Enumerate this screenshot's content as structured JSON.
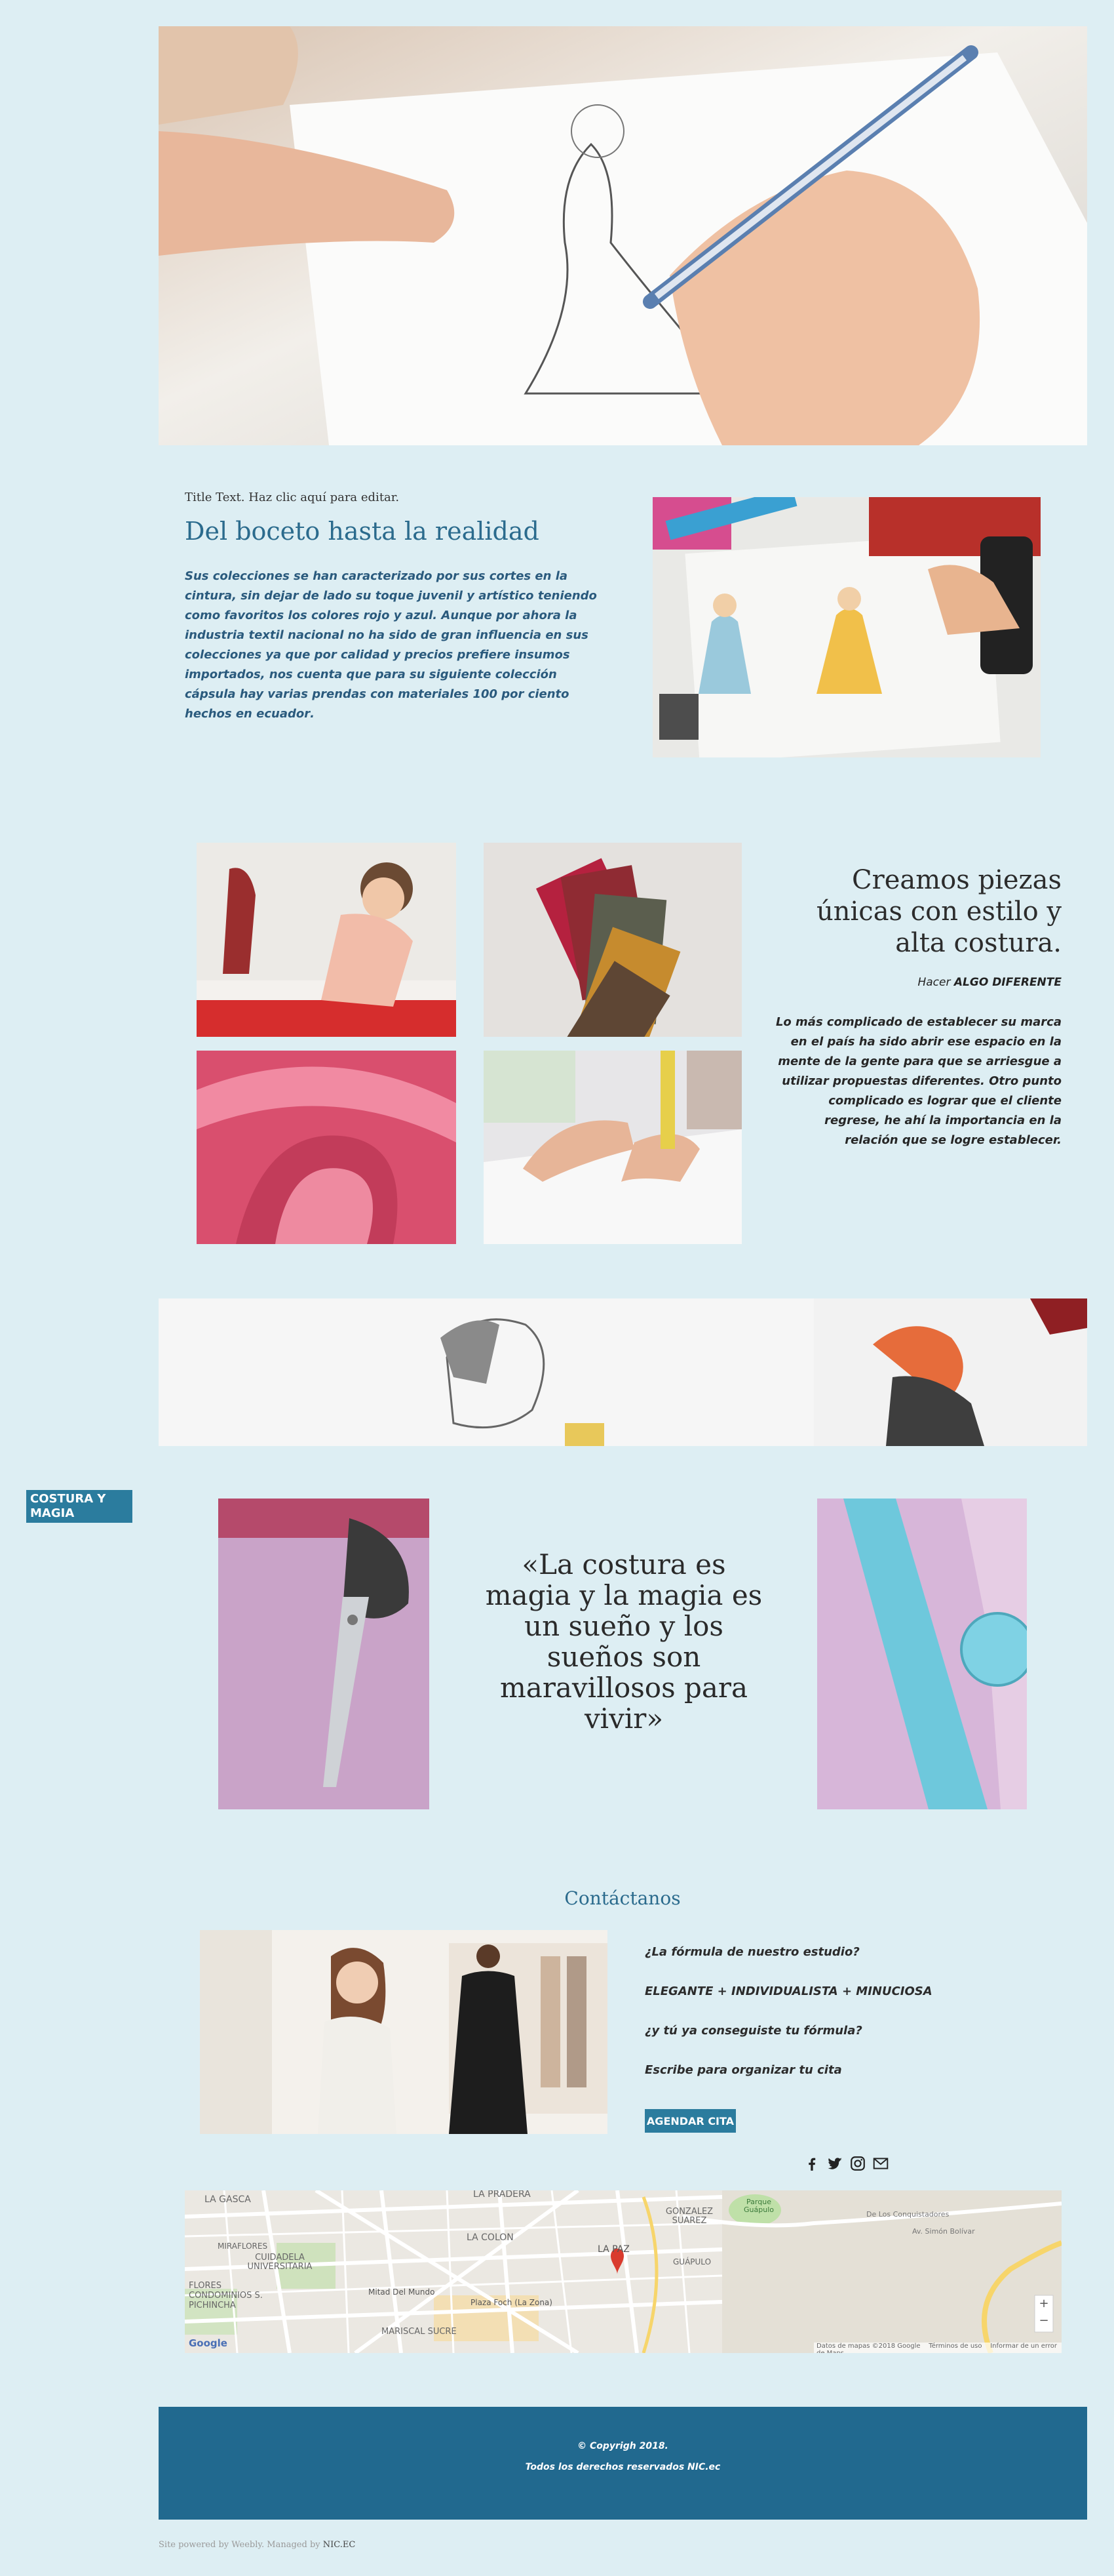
{
  "hero": {
    "image": "hand-sketching-dress-photo"
  },
  "intro": {
    "small_title": "Title Text. Haz clic aquí para editar.",
    "heading": "Del boceto hasta la realidad",
    "p1": "Sus colecciones se han caracterizado por sus ",
    "b1": "cortes en la cintura",
    "p2": ", sin dejar de lado su ",
    "b2": "toque juvenil y artístico",
    "p3": " teniendo como favoritos los colores rojo y azul. Aunque por ahora la industria textil nacional no ha sido de gran influencia en sus colecciones ya que por calidad y precios prefiere insumos importados, nos cuenta que para su siguiente colección cápsula hay varias prendas con ",
    "b3": "materiales 100 por ciento hechos en ecuador",
    "p4": ".",
    "image": "fashion-sketch-desk-photo"
  },
  "section2": {
    "heading": "Creamos piezas únicas con estilo y alta costura.",
    "sub_prefix": "Hacer ",
    "sub_bold": "ALGO DIFERENTE",
    "t1": "Lo más complicado de ",
    "b1": "establecer su marca en el país",
    "t2": " ha sido abrir ese espacio en la mente de la gente para que se ",
    "b2": "arriesgue a utilizar propuestas diferentes.",
    "t3": " Otro punto complicado es lograr que el cliente regrese, he ahí la importancia en la relación que se logre establecer.",
    "images": [
      "woman-cutting-fabric",
      "fabric-swatches",
      "pink-ribbon",
      "hands-measuring-fabric"
    ]
  },
  "banner": {
    "image": "sketch-banner"
  },
  "section3": {
    "side_tag": "COSTURA Y MAGIA",
    "quote": "«La costura es magia y la magia es un sueño y los sueños son maravillosos para vivir»",
    "images": [
      "scissors-photo",
      "measuring-tape-photo"
    ]
  },
  "contact": {
    "heading": "Contáctanos",
    "line1": "¿La fórmula de nuestro estudio?",
    "line2": "ELEGANTE + INDIVIDUALISTA + MINUCIOSA",
    "line3": "¿y tú ya conseguiste tu fórmula?",
    "line4": "Escribe para organizar tu cita",
    "button": "AGENDAR CITA",
    "social": [
      "facebook-icon",
      "twitter-icon",
      "instagram-icon",
      "mail-icon"
    ]
  },
  "map": {
    "labels": [
      "LA GASCA",
      "LA PRADERA",
      "LA PAZ",
      "MIRAFLORES",
      "CUIDADELA UNIVERSITARIA",
      "LA COLON",
      "GONZALEZ SUAREZ",
      "FLORES CONDOMINIOS S. PICHINCHA",
      "Mitad Del Mundo",
      "Plaza Foch (La Zona)",
      "GUÁPULO",
      "MARISCAL SUCRE",
      "Parque Guápulo",
      "De Los Conquistadores",
      "Av. Simón Bolívar"
    ],
    "attribution": "Datos de mapas ©2018 Google",
    "terms": "Términos de uso",
    "report": "Informar de un error de Maps",
    "google": "Google",
    "zoom_in": "+",
    "zoom_out": "−"
  },
  "footer": {
    "copyright": "© Copyrigh 2018.",
    "rights": "Todos los derechos reservados NIC.ec"
  },
  "powered": {
    "text": "Site powered by Weebly. Managed by ",
    "brand": "NIC.EC"
  }
}
